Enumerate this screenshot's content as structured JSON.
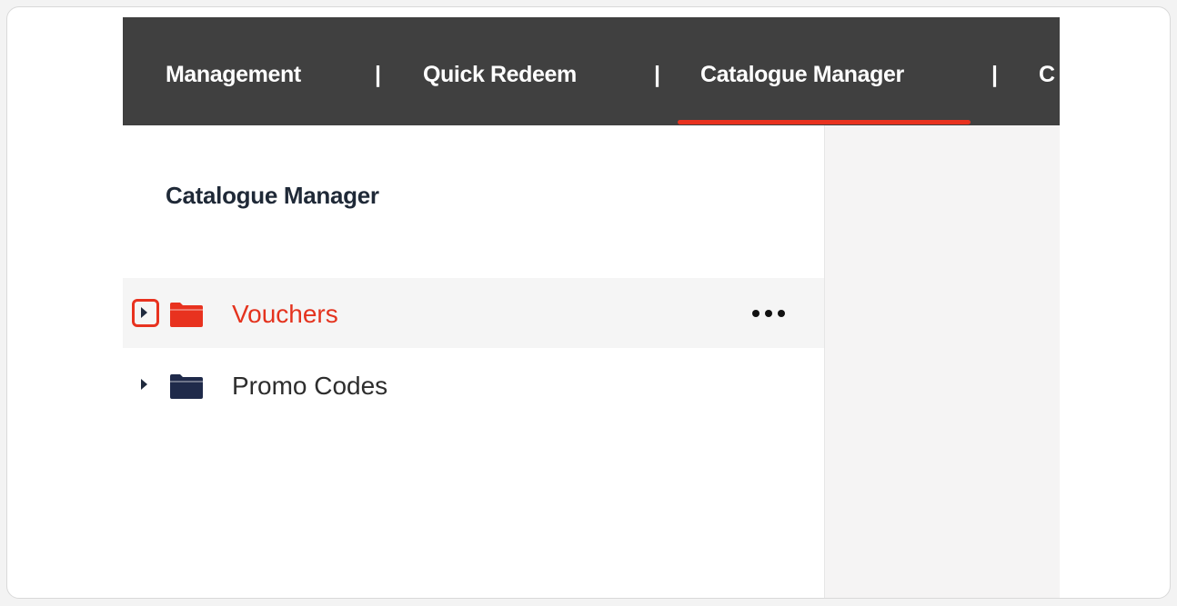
{
  "topnav": {
    "items": [
      {
        "label": "Management"
      },
      {
        "label": "Quick Redeem"
      },
      {
        "label": "Catalogue Manager"
      },
      {
        "label": "C"
      }
    ],
    "separator": "|",
    "active_item": "Catalogue Manager",
    "active_color": "#e8321f",
    "background": "#404040"
  },
  "sidebar": {
    "title": "Catalogue Manager",
    "items": [
      {
        "label": "Vouchers",
        "icon": "folder-icon",
        "expander_icon": "caret-right-icon",
        "selected": true,
        "color": "#e4331e",
        "more_icon": "ellipsis-icon"
      },
      {
        "label": "Promo Codes",
        "icon": "folder-icon",
        "expander_icon": "caret-right-icon",
        "selected": false,
        "color": "#1f2a4a"
      }
    ]
  },
  "colors": {
    "accent": "#e8321f",
    "folder_dark": "#1f2a4a",
    "right_pane": "#f5f4f4"
  }
}
